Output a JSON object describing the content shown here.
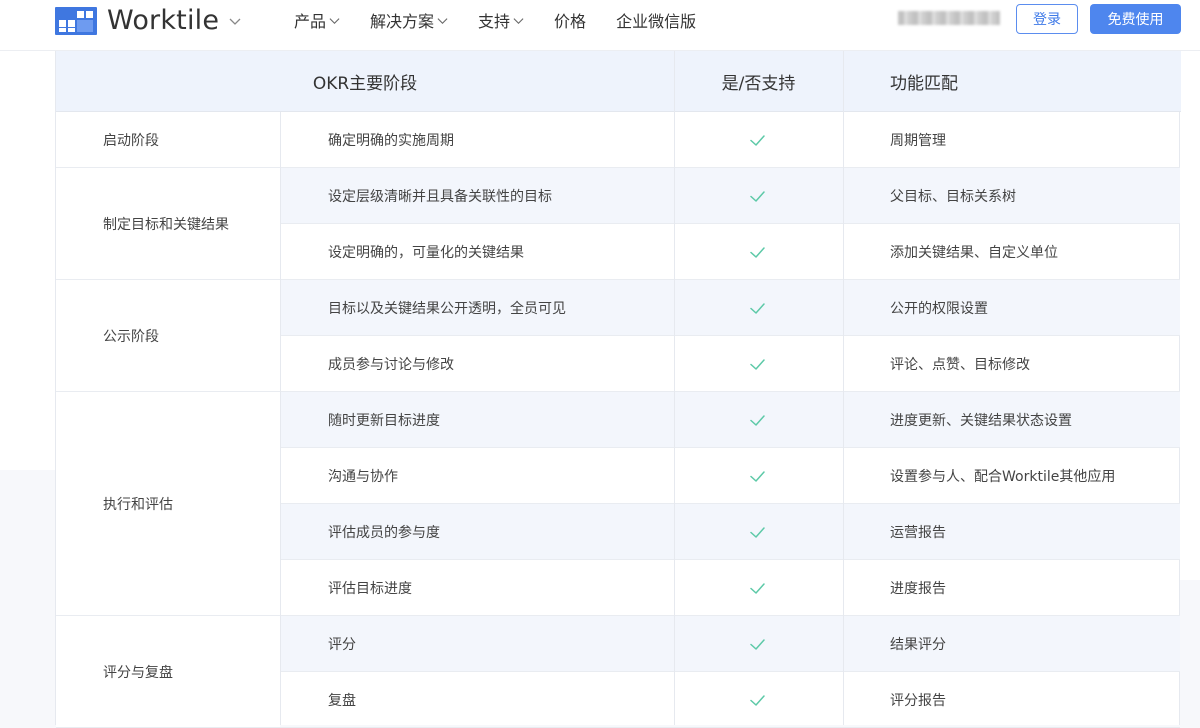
{
  "header": {
    "brand": "Worktile",
    "nav": [
      {
        "label": "产品",
        "has_dropdown": true
      },
      {
        "label": "解决方案",
        "has_dropdown": true
      },
      {
        "label": "支持",
        "has_dropdown": true
      },
      {
        "label": "价格",
        "has_dropdown": false
      },
      {
        "label": "企业微信版",
        "has_dropdown": false
      }
    ],
    "login_label": "登录",
    "free_label": "免费使用"
  },
  "table": {
    "headers": {
      "stage": "OKR主要阶段",
      "support": "是/否支持",
      "feature": "功能匹配"
    },
    "phases": [
      {
        "name": "启动阶段",
        "rows": [
          {
            "item": "确定明确的实施周期",
            "supported": true,
            "feature": "周期管理"
          }
        ]
      },
      {
        "name": "制定目标和关键结果",
        "rows": [
          {
            "item": "设定层级清晰并且具备关联性的目标",
            "supported": true,
            "feature": "父目标、目标关系树"
          },
          {
            "item": "设定明确的，可量化的关键结果",
            "supported": true,
            "feature": "添加关键结果、自定义单位"
          }
        ]
      },
      {
        "name": "公示阶段",
        "rows": [
          {
            "item": "目标以及关键结果公开透明，全员可见",
            "supported": true,
            "feature": "公开的权限设置"
          },
          {
            "item": "成员参与讨论与修改",
            "supported": true,
            "feature": "评论、点赞、目标修改"
          }
        ]
      },
      {
        "name": "执行和评估",
        "rows": [
          {
            "item": "随时更新目标进度",
            "supported": true,
            "feature": "进度更新、关键结果状态设置"
          },
          {
            "item": "沟通与协作",
            "supported": true,
            "feature": "设置参与人、配合Worktile其他应用"
          },
          {
            "item": "评估成员的参与度",
            "supported": true,
            "feature": "运营报告"
          },
          {
            "item": "评估目标进度",
            "supported": true,
            "feature": "进度报告"
          }
        ]
      },
      {
        "name": "评分与复盘",
        "rows": [
          {
            "item": "评分",
            "supported": true,
            "feature": "结果评分"
          },
          {
            "item": "复盘",
            "supported": true,
            "feature": "评分报告"
          }
        ]
      }
    ]
  },
  "colors": {
    "accent": "#4e86ee",
    "check": "#5cc9a7",
    "header_bg": "#eef3fc",
    "row_shade": "#f3f6fc"
  }
}
